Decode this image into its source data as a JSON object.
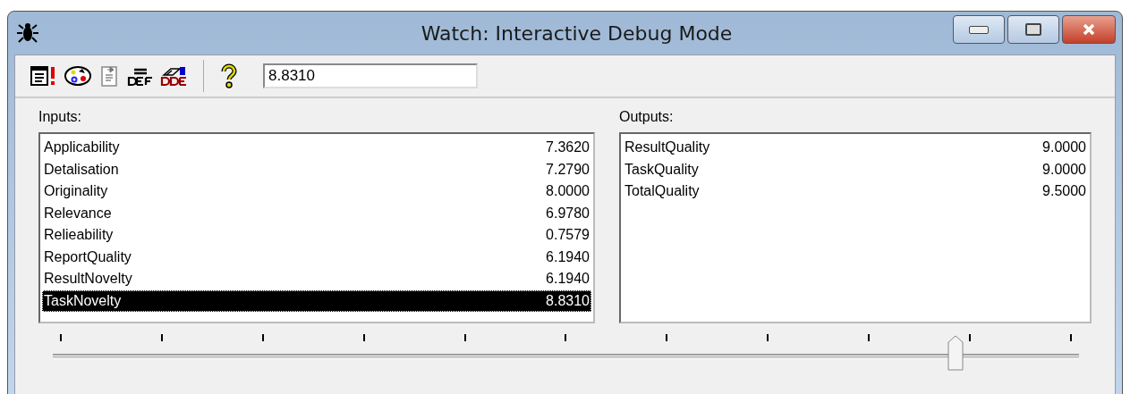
{
  "window": {
    "title": "Watch: Interactive Debug Mode"
  },
  "toolbar": {
    "value": "8.8310"
  },
  "inputs": {
    "label": "Inputs:",
    "rows": [
      {
        "name": "Applicability",
        "value": "7.3620",
        "selected": false
      },
      {
        "name": "Detalisation",
        "value": "7.2790",
        "selected": false
      },
      {
        "name": "Originality",
        "value": "8.0000",
        "selected": false
      },
      {
        "name": "Relevance",
        "value": "6.9780",
        "selected": false
      },
      {
        "name": "Relieability",
        "value": "0.7579",
        "selected": false
      },
      {
        "name": "ReportQuality",
        "value": "6.1940",
        "selected": false
      },
      {
        "name": "ResultNovelty",
        "value": "6.1940",
        "selected": false
      },
      {
        "name": "TaskNovelty",
        "value": "8.8310",
        "selected": true
      }
    ]
  },
  "outputs": {
    "label": "Outputs:",
    "rows": [
      {
        "name": "ResultQuality",
        "value": "9.0000",
        "selected": false
      },
      {
        "name": "TaskQuality",
        "value": "9.0000",
        "selected": false
      },
      {
        "name": "TotalQuality",
        "value": "9.5000",
        "selected": false
      }
    ]
  },
  "slider": {
    "level": 0.88
  }
}
